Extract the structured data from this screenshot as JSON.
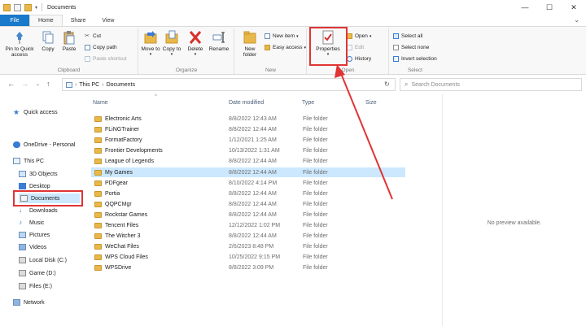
{
  "window": {
    "title": "Documents",
    "controls": [
      "—",
      "☐",
      "✕"
    ]
  },
  "ribbon_tabs": [
    "File",
    "Home",
    "Share",
    "View"
  ],
  "ribbon": {
    "clipboard": {
      "label": "Clipboard",
      "pin": "Pin to Quick access",
      "copy": "Copy",
      "paste": "Paste",
      "cut": "Cut",
      "copy_path": "Copy path",
      "paste_shortcut": "Paste shortcut"
    },
    "organize": {
      "label": "Organize",
      "move_to": "Move to",
      "copy_to": "Copy to",
      "delete": "Delete",
      "rename": "Rename"
    },
    "new": {
      "label": "New",
      "new_folder": "New folder",
      "new_item": "New item",
      "easy_access": "Easy access"
    },
    "open": {
      "label": "Open",
      "properties": "Properties",
      "open": "Open",
      "edit": "Edit",
      "history": "History"
    },
    "select": {
      "label": "Select",
      "select_all": "Select all",
      "select_none": "Select none",
      "invert": "Invert selection"
    }
  },
  "address": {
    "path": [
      "This PC",
      "Documents"
    ],
    "search_placeholder": "Search Documents"
  },
  "nav": {
    "quick_access": "Quick access",
    "onedrive": "OneDrive - Personal",
    "this_pc": "This PC",
    "items": [
      "3D Objects",
      "Desktop",
      "Documents",
      "Downloads",
      "Music",
      "Pictures",
      "Videos",
      "Local Disk (C:)",
      "Game (D:)",
      "Files (E:)"
    ],
    "network": "Network"
  },
  "columns": {
    "name": "Name",
    "date": "Date modified",
    "type": "Type",
    "size": "Size"
  },
  "files": [
    {
      "name": "Electronic Arts",
      "date": "8/8/2022 12:43 AM",
      "type": "File folder"
    },
    {
      "name": "FLiNGTrainer",
      "date": "8/8/2022 12:44 AM",
      "type": "File folder"
    },
    {
      "name": "FormatFactory",
      "date": "1/12/2021 1:25 AM",
      "type": "File folder"
    },
    {
      "name": "Frontier Developments",
      "date": "10/13/2022 1:31 AM",
      "type": "File folder"
    },
    {
      "name": "League of Legends",
      "date": "8/8/2022 12:44 AM",
      "type": "File folder"
    },
    {
      "name": "My Games",
      "date": "8/8/2022 12:44 AM",
      "type": "File folder"
    },
    {
      "name": "PDFgear",
      "date": "8/10/2022 4:14 PM",
      "type": "File folder"
    },
    {
      "name": "Portia",
      "date": "8/8/2022 12:44 AM",
      "type": "File folder"
    },
    {
      "name": "QQPCMgr",
      "date": "8/8/2022 12:44 AM",
      "type": "File folder"
    },
    {
      "name": "Rockstar Games",
      "date": "8/8/2022 12:44 AM",
      "type": "File folder"
    },
    {
      "name": "Tencent Files",
      "date": "12/12/2022 1:02 PM",
      "type": "File folder"
    },
    {
      "name": "The Witcher 3",
      "date": "8/8/2022 12:44 AM",
      "type": "File folder"
    },
    {
      "name": "WeChat Files",
      "date": "2/6/2023 8:48 PM",
      "type": "File folder"
    },
    {
      "name": "WPS Cloud Files",
      "date": "10/25/2022 9:15 PM",
      "type": "File folder"
    },
    {
      "name": "WPSDrive",
      "date": "8/8/2022 3:09 PM",
      "type": "File folder"
    }
  ],
  "preview": {
    "text": "No preview available."
  },
  "colors": {
    "accent": "#1979ca",
    "selection": "#cce8ff",
    "highlight": "#e03434",
    "folder": "#e8b84a"
  }
}
